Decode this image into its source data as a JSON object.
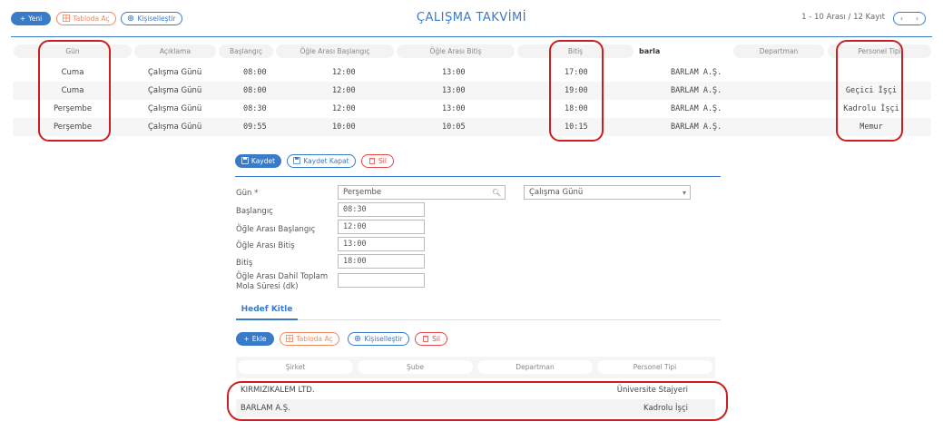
{
  "toolbar": {
    "new_label": "Yeni",
    "table_label": "Tabloda Aç",
    "customize_label": "Kişiselleştir"
  },
  "page_title": "ÇALIŞMA TAKVİMİ",
  "paging": {
    "summary": "1 - 10 Arası  /  12 Kayıt",
    "prev": "‹",
    "next": "›"
  },
  "table": {
    "columns": [
      "Gün",
      "Açıklama",
      "Başlangıç",
      "Öğle Arası Başlangıç",
      "Öğle Arası Bitiş",
      "Bitiş",
      "barla",
      "Departman",
      "Personel Tipi"
    ],
    "rows": [
      [
        "Cuma",
        "Çalışma Günü",
        "08:00",
        "12:00",
        "13:00",
        "17:00",
        "BARLAM A.Ş.",
        "",
        ""
      ],
      [
        "Cuma",
        "Çalışma Günü",
        "08:00",
        "12:00",
        "13:00",
        "19:00",
        "BARLAM A.Ş.",
        "",
        "Geçici İşçi"
      ],
      [
        "Perşembe",
        "Çalışma Günü",
        "08:30",
        "12:00",
        "13:00",
        "18:00",
        "BARLAM A.Ş.",
        "",
        "Kadrolu İşçi"
      ],
      [
        "Perşembe",
        "Çalışma Günü",
        "09:55",
        "10:00",
        "10:05",
        "10:15",
        "BARLAM A.Ş.",
        "",
        "Memur"
      ]
    ]
  },
  "form_actions": {
    "save_label": "Kaydet",
    "save_close_label": "Kaydet Kapat",
    "delete_label": "Sil"
  },
  "form": {
    "day_label": "Gün *",
    "day_value": "Perşembe",
    "type_value": "Çalışma Günü",
    "start_label": "Başlangıç",
    "start_value": "08:30",
    "lunch_start_label": "Öğle Arası Başlangıç",
    "lunch_start_value": "12:00",
    "lunch_end_label": "Öğle Arası Bitiş",
    "lunch_end_value": "13:00",
    "end_label": "Bitiş",
    "end_value": "18:00",
    "break_total_label_1": "Öğle Arası Dahil Toplam",
    "break_total_label_2": "Mola Süresi (dk)",
    "break_total_value": ""
  },
  "tab": {
    "label": "Hedef Kitle"
  },
  "sub_toolbar": {
    "add_label": "Ekle",
    "table_label": "Tabloda Aç",
    "customize_label": "Kişiselleştir",
    "delete_label": "Sil"
  },
  "sub_table": {
    "columns": [
      "Şirket",
      "Şube",
      "Departman",
      "Personel Tipi"
    ],
    "rows": [
      [
        "KIRMIZIKALEM LTD.",
        "Üniversite Stajyeri"
      ],
      [
        "BARLAM A.Ş.",
        "Kadrolu İşçi"
      ]
    ]
  },
  "colors": {
    "accent": "#3a7bc8",
    "highlight": "#cc1f1f",
    "orange": "#f08a5d",
    "danger": "#e04848"
  }
}
